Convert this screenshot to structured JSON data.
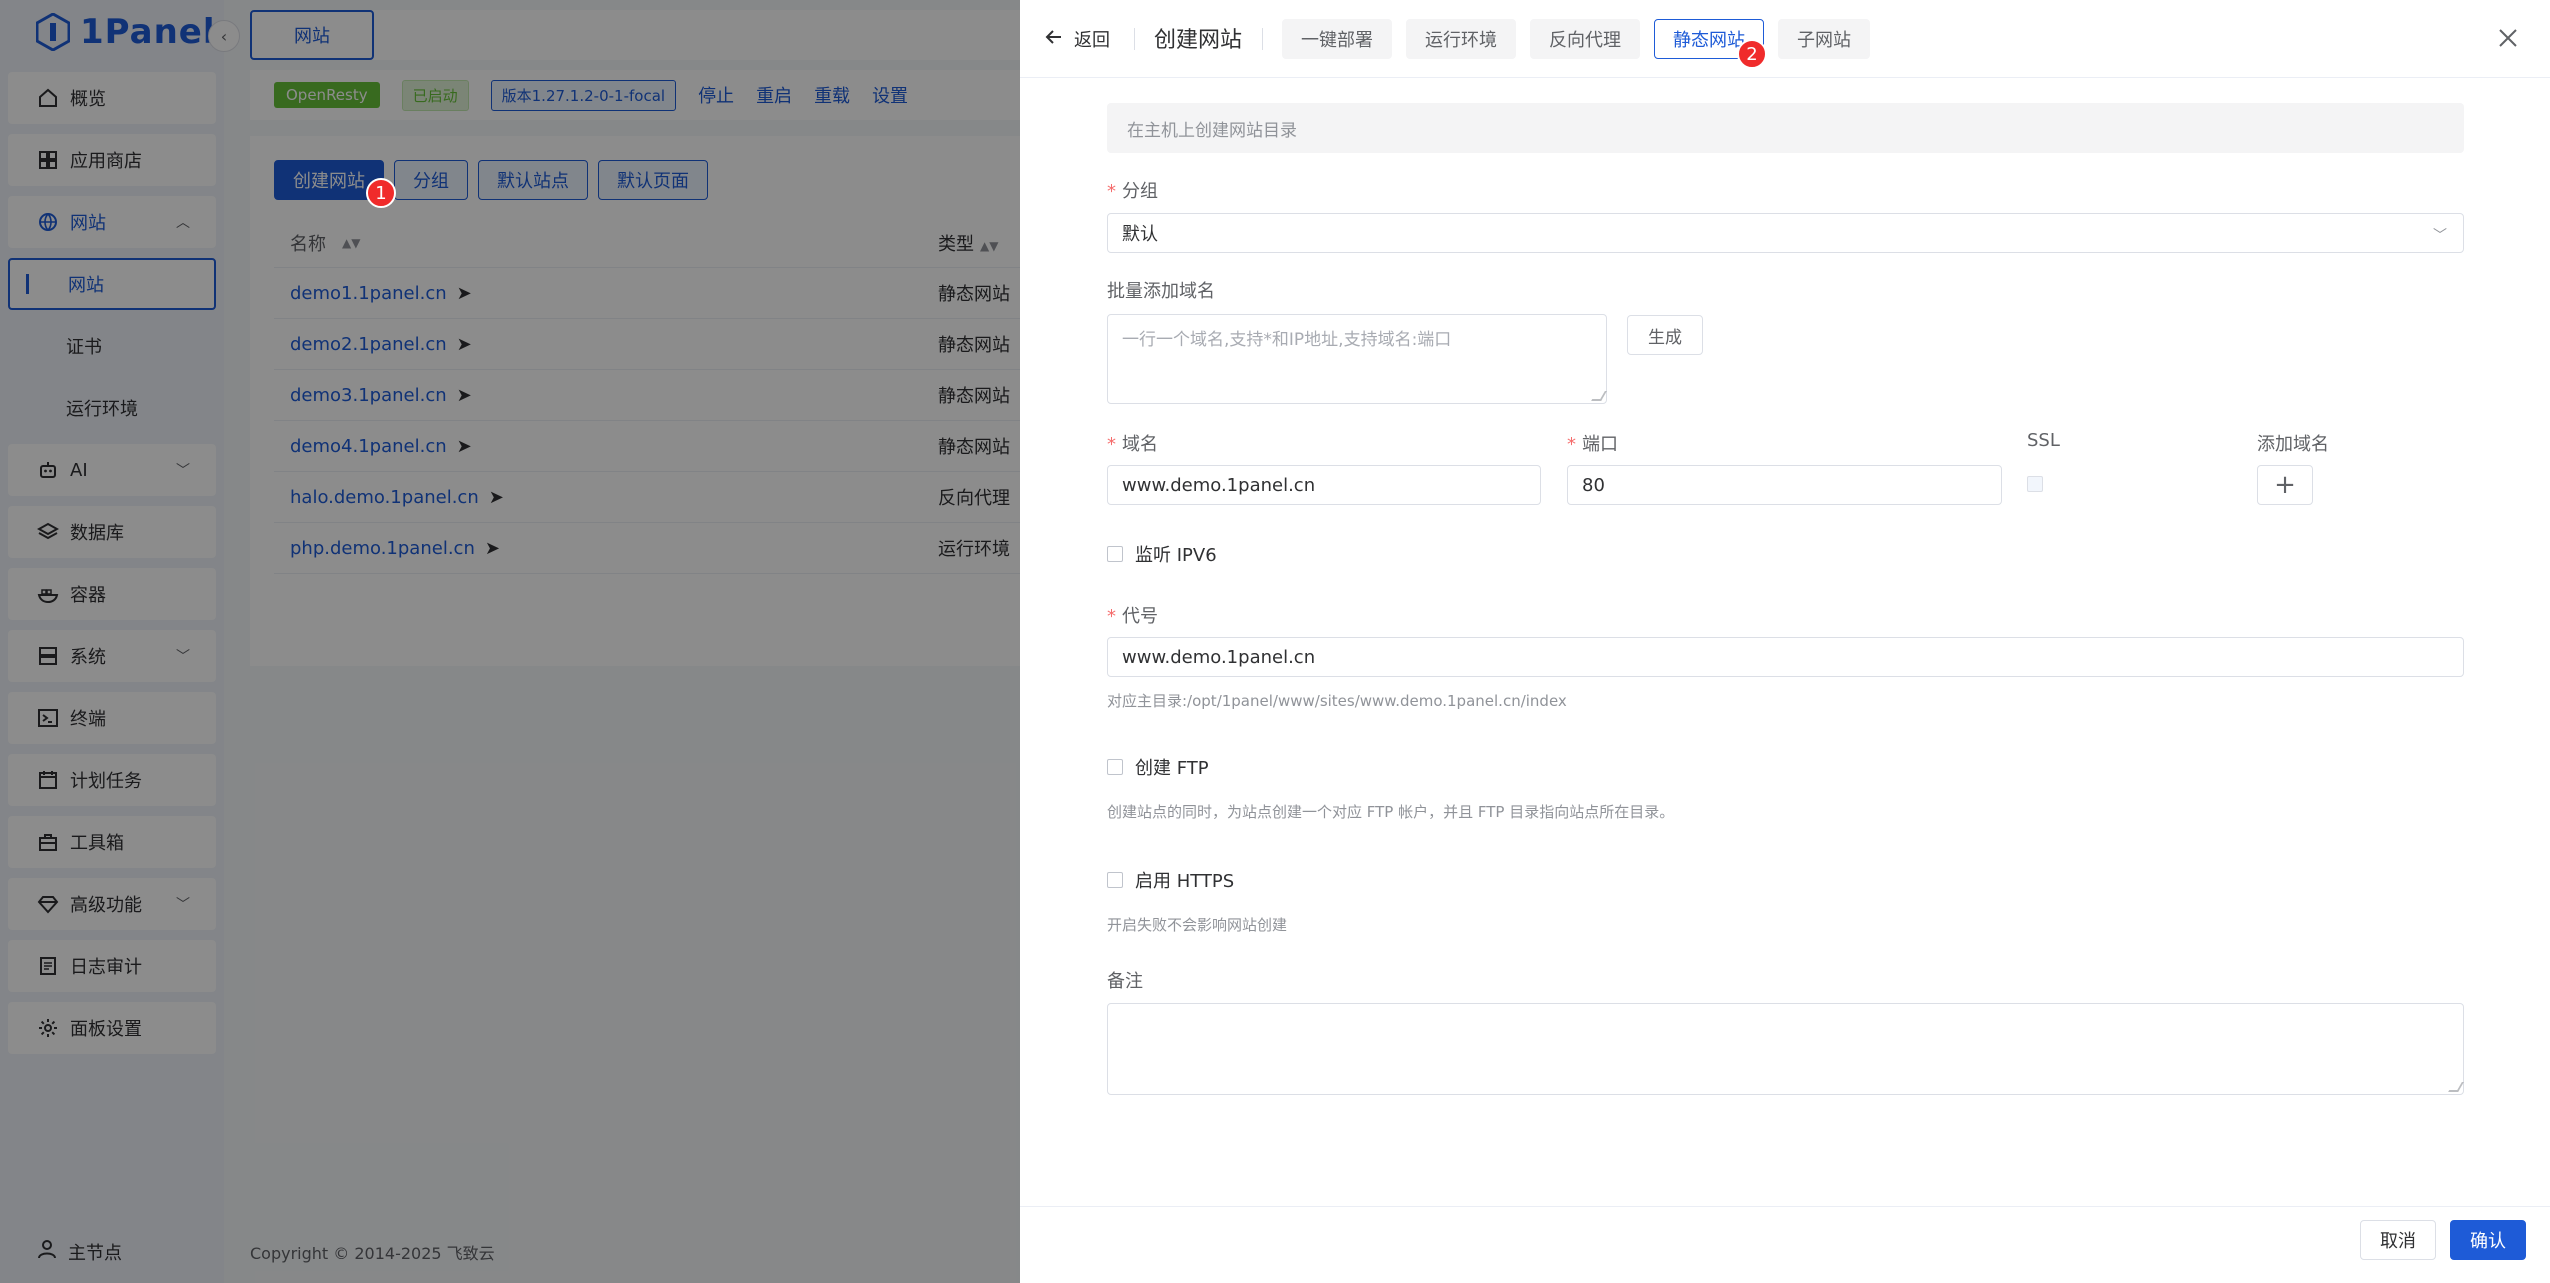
{
  "brand": {
    "name": "1Panel"
  },
  "sidebar": {
    "items": [
      {
        "label": "概览",
        "icon": "home-icon"
      },
      {
        "label": "应用商店",
        "icon": "grid-icon"
      },
      {
        "label": "网站",
        "icon": "globe-icon",
        "open": true
      },
      {
        "label": "AI",
        "icon": "robot-icon"
      },
      {
        "label": "数据库",
        "icon": "layers-icon"
      },
      {
        "label": "容器",
        "icon": "container-icon"
      },
      {
        "label": "系统",
        "icon": "server-icon"
      },
      {
        "label": "终端",
        "icon": "terminal-icon"
      },
      {
        "label": "计划任务",
        "icon": "calendar-icon"
      },
      {
        "label": "工具箱",
        "icon": "toolbox-icon"
      },
      {
        "label": "高级功能",
        "icon": "diamond-icon"
      },
      {
        "label": "日志审计",
        "icon": "log-icon"
      },
      {
        "label": "面板设置",
        "icon": "gear-icon"
      }
    ],
    "sub_items": [
      {
        "label": "网站",
        "active": true
      },
      {
        "label": "证书"
      },
      {
        "label": "运行环境"
      }
    ],
    "node_label": "主节点"
  },
  "main": {
    "tab": "网站",
    "status": {
      "app": "OpenResty",
      "state": "已启动",
      "version": "版本1.27.1.2-0-1-focal",
      "actions": [
        "停止",
        "重启",
        "重载",
        "设置"
      ]
    },
    "buttons": [
      "创建网站",
      "分组",
      "默认站点",
      "默认页面"
    ],
    "table": {
      "headers": {
        "name": "名称",
        "type": "类型"
      },
      "rows": [
        {
          "name": "demo1.1panel.cn",
          "type": "静态网站"
        },
        {
          "name": "demo2.1panel.cn",
          "type": "静态网站"
        },
        {
          "name": "demo3.1panel.cn",
          "type": "静态网站"
        },
        {
          "name": "demo4.1panel.cn",
          "type": "静态网站"
        },
        {
          "name": "halo.demo.1panel.cn",
          "type": "反向代理"
        },
        {
          "name": "php.demo.1panel.cn",
          "type": "运行环境"
        }
      ]
    },
    "copyright": "Copyright © 2014-2025 飞致云"
  },
  "badges": {
    "first": "1",
    "second": "2"
  },
  "drawer": {
    "back_label": "返回",
    "title": "创建网站",
    "type_tabs": [
      "一键部署",
      "运行环境",
      "反向代理",
      "静态网站",
      "子网站"
    ],
    "active_tab": "静态网站",
    "hint": "在主机上创建网站目录",
    "group_label": "分组",
    "group_value": "默认",
    "batch_label": "批量添加域名",
    "batch_placeholder": "一行一个域名,支持*和IP地址,支持域名:端口",
    "generate_label": "生成",
    "domain_label": "域名",
    "domain_value": "www.demo.1panel.cn",
    "port_label": "端口",
    "port_value": "80",
    "ssl_label": "SSL",
    "add_domain_label": "添加域名",
    "ipv6_label": "监听 IPV6",
    "alias_label": "代号",
    "alias_value": "www.demo.1panel.cn",
    "alias_help": "对应主目录:/opt/1panel/www/sites/www.demo.1panel.cn/index",
    "ftp_label": "创建 FTP",
    "ftp_help": "创建站点的同时，为站点创建一个对应 FTP 帐户，并且 FTP 目录指向站点所在目录。",
    "https_label": "启用 HTTPS",
    "https_help": "开启失败不会影响网站创建",
    "remark_label": "备注",
    "cancel_label": "取消",
    "confirm_label": "确认"
  },
  "colors": {
    "primary": "#1e5bd7",
    "badge": "#f02b2b",
    "success": "#67c23a"
  }
}
